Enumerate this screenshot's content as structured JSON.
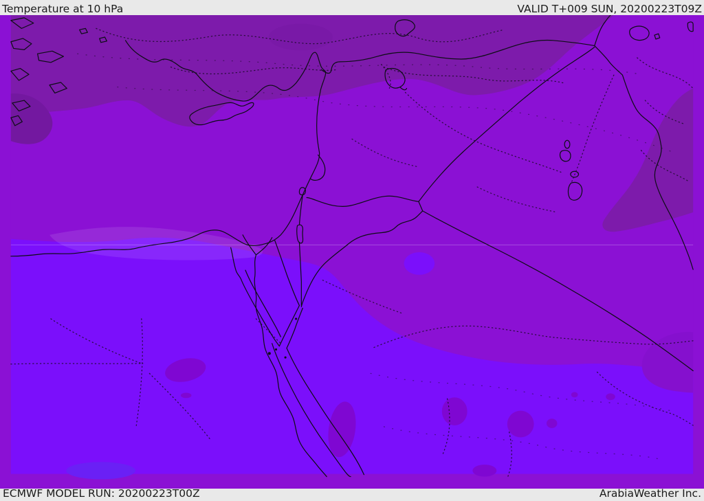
{
  "header": {
    "title": "Temperature at 10 hPa",
    "valid_label": "VALID T+009 SUN, 20200223T09Z"
  },
  "footer": {
    "model_run_label": "ECMWF MODEL RUN: 20200223T00Z",
    "brand_label": "ArabiaWeather Inc."
  },
  "map": {
    "type": "weather-forecast-map",
    "parameter": "Temperature at 10 hPa",
    "model": "ECMWF",
    "region": "Eastern Mediterranean / Middle East",
    "colors": {
      "band_mid_purple": "#8B11D4",
      "band_dark_purple": "#7D1BAB",
      "band_darkest_purple": "#7318A0",
      "band_bright_violet": "#7B0FFB",
      "band_south_blob_purple": "#7F07D2",
      "band_se_dark": "#8510CE",
      "band_blue_violet": "#6A20F5",
      "coast_stroke": "#0D0D15",
      "dotted_stroke": "#1A0A28",
      "halo": "rgba(255,255,255,0.10)",
      "lat_line": "rgba(255,255,255,0.28)",
      "ui_bar_bg": "#E9E9E9",
      "ui_text": "#1B1B1B"
    },
    "features": [
      "aegean-islands",
      "turkey-south-coast",
      "cyprus-island",
      "levant-coast",
      "egypt-coast-nile-delta",
      "suez-canal-gulf-of-suez",
      "gulf-of-aqaba",
      "red-sea-coasts",
      "nile-river",
      "sea-of-galilee",
      "dead-sea",
      "jordan-river",
      "turkey-syria-border",
      "turkey-iraq-border",
      "iraq-iran-border",
      "syria-iraq-border",
      "syria-jordan-border",
      "jordan-saudi-border",
      "iraq-saudi-border",
      "israel-egypt-border",
      "israel-jordan-border",
      "lake-assad",
      "lake-tuz",
      "lake-van",
      "lake-urmia-edge",
      "iraq-lakes",
      "temperature-shading-bands",
      "dotted-admin-graticule-lines"
    ]
  }
}
